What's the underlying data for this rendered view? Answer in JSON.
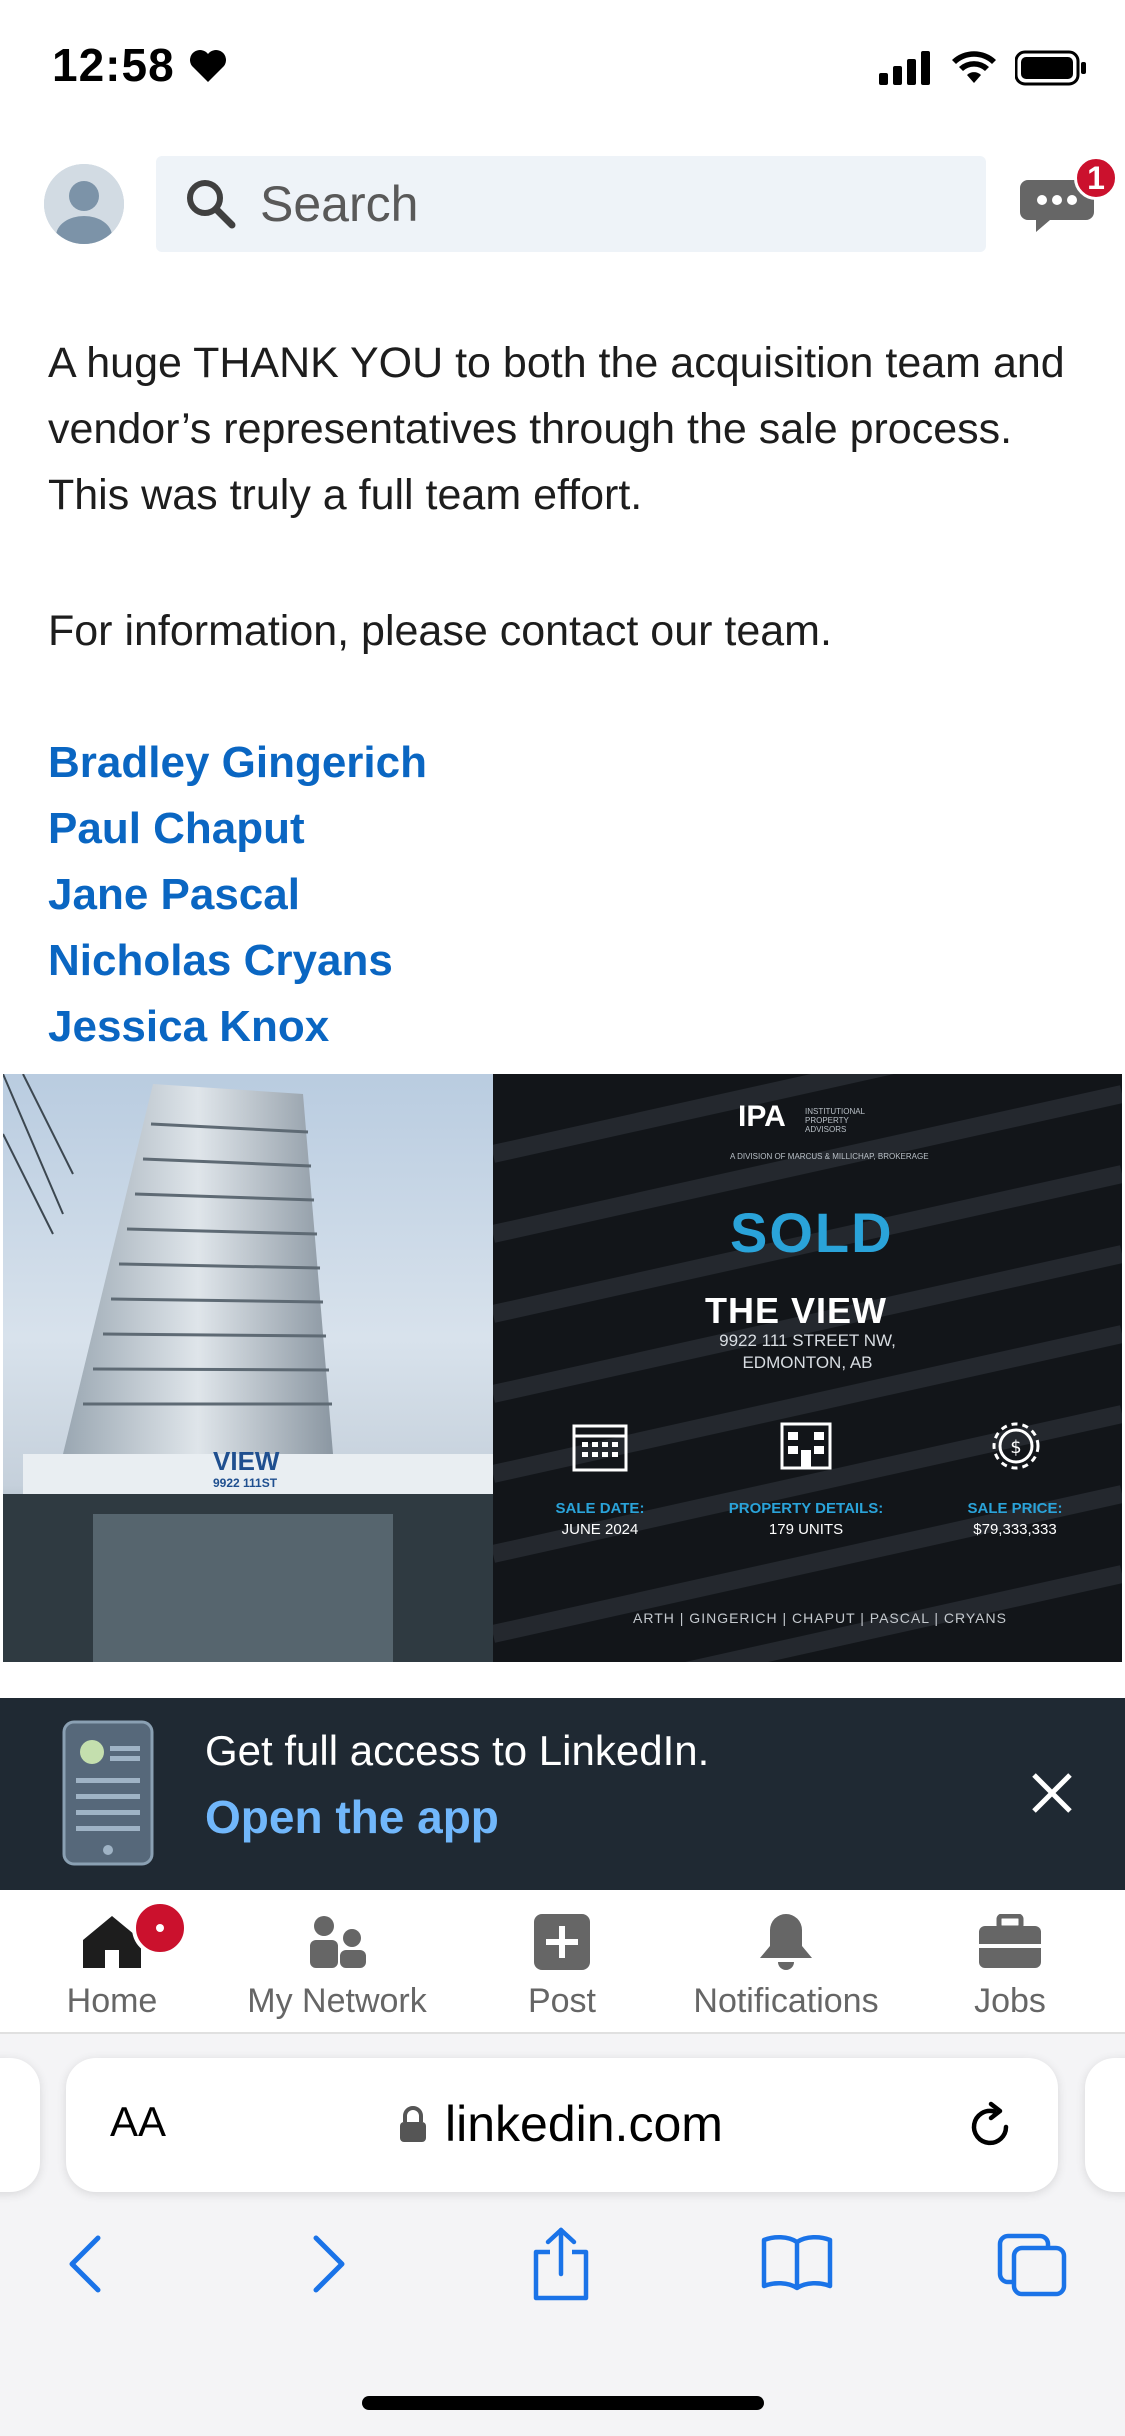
{
  "status_bar": {
    "time": "12:58"
  },
  "header": {
    "search_placeholder": "Search",
    "message_badge": "1"
  },
  "post": {
    "paragraph": "A huge THANK YOU to both the acquisition team and vendor’s representatives through the sale process. This was truly a full team effort.",
    "info": "For information, please contact our team.",
    "contacts": [
      "Bradley Gingerich",
      "Paul Chaput",
      "Jane Pascal",
      "Nicholas Cryans",
      "Jessica Knox"
    ],
    "image": {
      "logo": "IPA",
      "logo_sub": "INSTITUTIONAL PROPERTY ADVISORS",
      "logo_division": "A DIVISION OF MARCUS & MILLICHAP, BROKERAGE",
      "sold": "SOLD",
      "property": "THE VIEW",
      "address_line1": "9922 111 STREET NW,",
      "address_line2": "EDMONTON, AB",
      "building_sign": "VIEW",
      "building_number": "9922 111ST",
      "stats": [
        {
          "label": "SALE DATE:",
          "value": "JUNE 2024"
        },
        {
          "label": "PROPERTY DETAILS:",
          "value": "179 UNITS"
        },
        {
          "label": "SALE PRICE:",
          "value": "$79,333,333"
        }
      ],
      "team": "ARTH | GINGERICH | CHAPUT | PASCAL | CRYANS"
    }
  },
  "app_banner": {
    "title": "Get full access to LinkedIn.",
    "link": "Open the app"
  },
  "bottom_nav": [
    {
      "label": "Home"
    },
    {
      "label": "My Network"
    },
    {
      "label": "Post"
    },
    {
      "label": "Notifications"
    },
    {
      "label": "Jobs"
    }
  ],
  "safari": {
    "aa": "AA",
    "url": "linkedin.com"
  },
  "colors": {
    "link": "#0a66c2",
    "badge": "#cb112d",
    "banner_bg": "#1f2933",
    "banner_link": "#71b7fb",
    "sold_blue": "#2aa3d9"
  }
}
